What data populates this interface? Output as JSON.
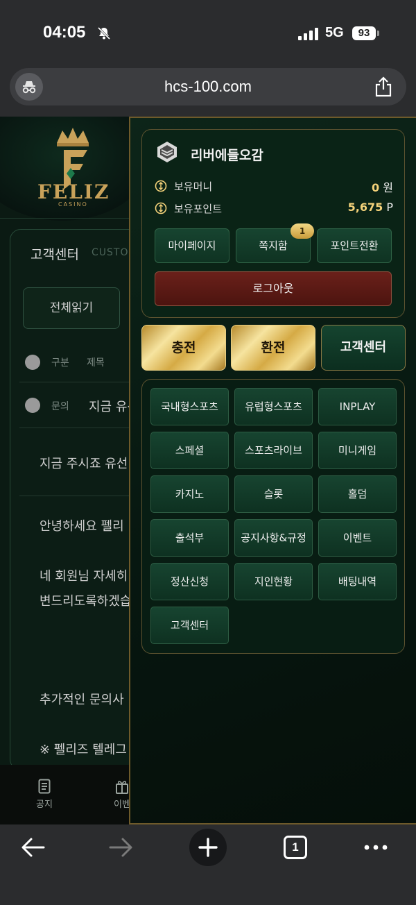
{
  "status": {
    "time": "04:05",
    "network": "5G",
    "battery": "93"
  },
  "browser": {
    "url": "hcs-100.com",
    "tab_count": "1"
  },
  "brand": {
    "logo_text": "FELIZ",
    "logo_sub": "CASINO"
  },
  "background_page": {
    "title": "고객센터",
    "title_en": "CUSTOM",
    "read_all_button": "전체읽기",
    "header_col1": "구분",
    "header_col2": "제목",
    "row_type": "문의",
    "row_title": "지금 유선",
    "body_lines": [
      "지금 주시죠 유선",
      "안녕하세요 펠리",
      "네 회원님 자세히",
      "변드리도록하겠습",
      "추가적인 문의사",
      "※ 펠리즈 텔레그"
    ],
    "bottom_nav": [
      "공지",
      "이벤"
    ]
  },
  "user": {
    "name": "리버에들오감",
    "money_label": "보유머니",
    "money_value": "0",
    "money_unit": "원",
    "points_label": "보유포인트",
    "points_value": "5,675",
    "points_unit": "P"
  },
  "account_buttons": {
    "mypage": "마이페이지",
    "messages": "쪽지함",
    "messages_badge": "1",
    "convert_points": "포인트전환",
    "logout": "로그아웃"
  },
  "action_buttons": {
    "deposit": "충전",
    "withdraw": "환전",
    "support": "고객센터"
  },
  "menu": [
    "국내형스포츠",
    "유럽형스포츠",
    "INPLAY",
    "스페셜",
    "스포츠라이브",
    "미니게임",
    "카지노",
    "슬롯",
    "홀덤",
    "출석부",
    "공지사항&규정",
    "이벤트",
    "정산신청",
    "지인현황",
    "배팅내역",
    "고객센터"
  ],
  "colors": {
    "gold": "#d5aa45",
    "panel_green": "#0a2316",
    "logout_red": "#6a201a",
    "badge_gold": "#f3d885"
  }
}
